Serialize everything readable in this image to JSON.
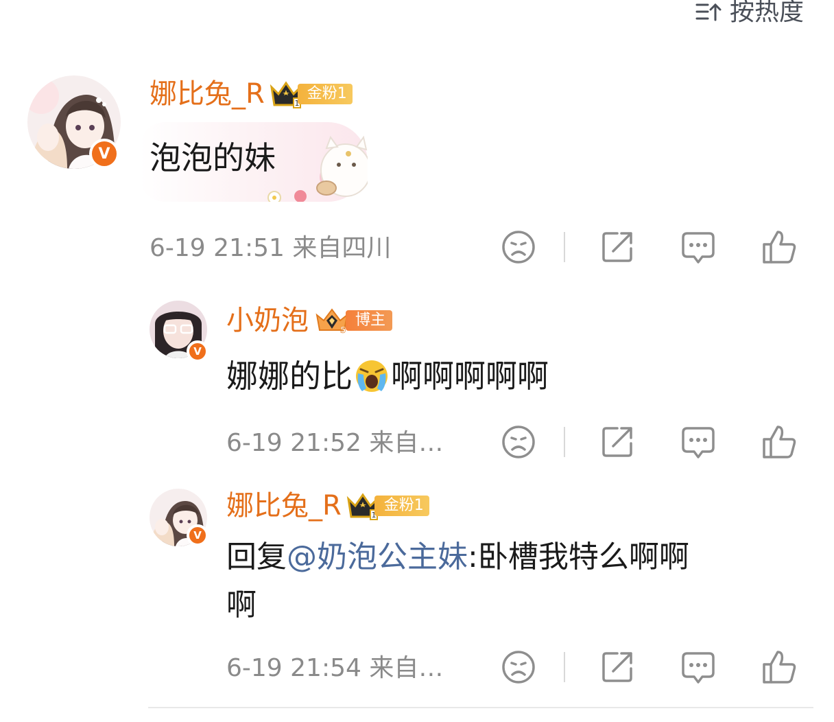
{
  "sort": {
    "label": "按热度"
  },
  "comments": [
    {
      "username": "娜比兔_R",
      "badge": "金粉1",
      "badge_level": "1",
      "text": "泡泡的妹",
      "meta": "6-19 21:51  来自四川"
    },
    {
      "username": "小奶泡",
      "badge": "博主",
      "badge_level": "5",
      "text_before": "娜娜的比",
      "text_after": "啊啊啊啊啊",
      "meta": "6-19 21:52  来自…"
    },
    {
      "username": "娜比兔_R",
      "badge": "金粉1",
      "badge_level": "1",
      "reply_prefix": "回复",
      "mention": "@奶泡公主妹",
      "reply_text": ":卧槽我特么啊啊",
      "reply_text_line2": "啊",
      "meta": "6-19 21:54  来自…"
    }
  ],
  "colors": {
    "username": "#e46f1a",
    "mention": "#4b6a9b",
    "meta": "#8a8a8a",
    "verified": "#f06f1b"
  },
  "icons": [
    "sort-icon",
    "verified-icon",
    "dislike-face-icon",
    "share-icon",
    "comment-icon",
    "like-icon"
  ]
}
